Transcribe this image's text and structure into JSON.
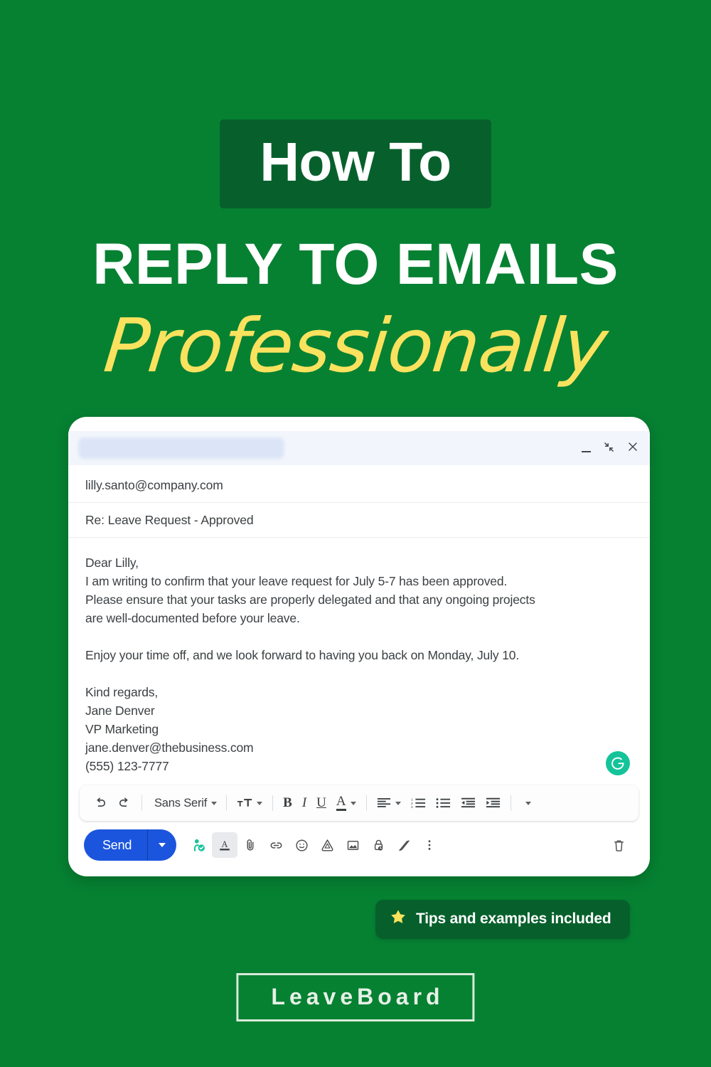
{
  "theme": {
    "background_green": "#068132",
    "badge_dark_green": "#07602C",
    "accent_yellow": "#FAE25E",
    "send_blue": "#1B55DD",
    "grammarly_teal": "#15C39A"
  },
  "hero": {
    "eyebrow": "How To",
    "headline": "REPLY TO EMAILS",
    "script": "Professionally"
  },
  "email": {
    "window": {
      "title_redacted": "",
      "minimize_label": "Minimize",
      "exit_fullscreen_label": "Exit full screen",
      "close_label": "Close"
    },
    "to": "lilly.santo@company.com",
    "subject": "Re: Leave Request - Approved",
    "body": {
      "greeting": "Dear Lilly,",
      "line1": "I am writing to confirm that your leave request for July 5-7 has been approved.",
      "line2": "Please ensure that your tasks are properly delegated and that any ongoing projects",
      "line3": "are well-documented before your leave.",
      "line4": "Enjoy your time off, and we look forward to having you back on Monday, July 10.",
      "sign_off": "Kind regards,",
      "sender_name": "Jane Denver",
      "sender_title": "VP Marketing",
      "sender_email": "jane.denver@thebusiness.com",
      "sender_phone": "(555) 123-7777"
    },
    "grammarly_glyph": "G",
    "format_toolbar": {
      "undo": "undo-icon",
      "redo": "redo-icon",
      "font_family": "Sans Serif",
      "font_size": "tT",
      "bold": "B",
      "italic": "I",
      "underline": "U",
      "text_color": "A",
      "align": "align-left-icon",
      "numbered_list": "numbered-list-icon",
      "bulleted_list": "bulleted-list-icon",
      "indent_less": "indent-less-icon",
      "indent_more": "indent-more-icon",
      "more": "more-formatting-icon"
    },
    "action_bar": {
      "send_label": "Send",
      "send_options": "send-options-caret",
      "icons": [
        "grammarly-check-icon",
        "formatting-options-icon",
        "attach-file-icon",
        "insert-link-icon",
        "insert-emoji-icon",
        "insert-drive-file-icon",
        "insert-photo-icon",
        "confidential-mode-icon",
        "insert-signature-icon",
        "more-options-icon"
      ],
      "discard": "discard-draft-icon"
    }
  },
  "tips_badge": {
    "icon": "star-icon",
    "label": "Tips and examples included"
  },
  "footer": {
    "brand": "LeaveBoard"
  }
}
